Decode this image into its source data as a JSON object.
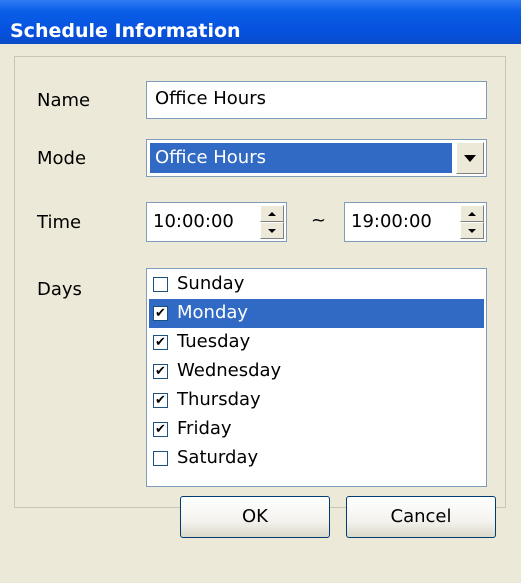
{
  "window": {
    "title": "Schedule Information"
  },
  "form": {
    "name_label": "Name",
    "name_value": "Office Hours",
    "mode_label": "Mode",
    "mode_value": "Office Hours",
    "time_label": "Time",
    "time_start": "10:00:00",
    "time_separator": "~",
    "time_end": "19:00:00",
    "days_label": "Days"
  },
  "days": [
    {
      "label": "Sunday",
      "checked": false,
      "selected": false
    },
    {
      "label": "Monday",
      "checked": true,
      "selected": true
    },
    {
      "label": "Tuesday",
      "checked": true,
      "selected": false
    },
    {
      "label": "Wednesday",
      "checked": true,
      "selected": false
    },
    {
      "label": "Thursday",
      "checked": true,
      "selected": false
    },
    {
      "label": "Friday",
      "checked": true,
      "selected": false
    },
    {
      "label": "Saturday",
      "checked": false,
      "selected": false
    }
  ],
  "buttons": {
    "ok": "OK",
    "cancel": "Cancel"
  },
  "icons": {
    "dropdown": "chevron-down-icon",
    "spin_up": "spin-up-icon",
    "spin_down": "spin-down-icon",
    "check": "checkmark-icon"
  },
  "colors": {
    "titlebar": "#0a5ee6",
    "selection": "#316ac5",
    "dialog_bg": "#ece9d8"
  }
}
